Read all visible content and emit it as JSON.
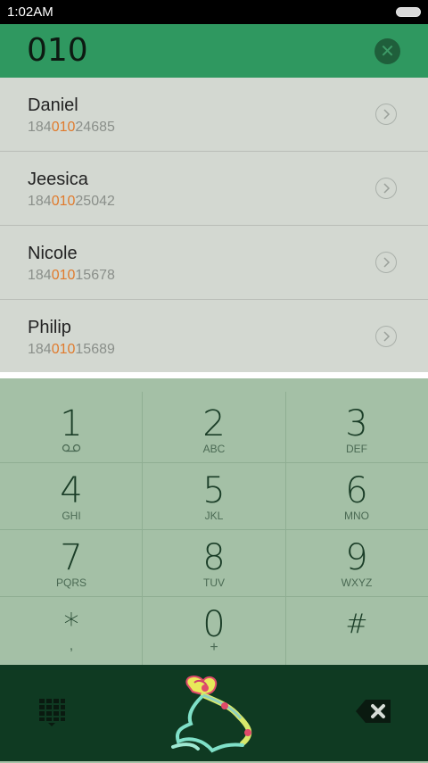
{
  "status_bar": {
    "time": "1:02AM"
  },
  "header": {
    "number": "010"
  },
  "results": [
    {
      "name": "Daniel",
      "prefix": "184",
      "match": "010",
      "suffix": "24685"
    },
    {
      "name": "Jeesica",
      "prefix": "184",
      "match": "010",
      "suffix": "25042"
    },
    {
      "name": "Nicole",
      "prefix": "184",
      "match": "010",
      "suffix": "15678"
    },
    {
      "name": "Philip",
      "prefix": "184",
      "match": "010",
      "suffix": "15689"
    }
  ],
  "keypad": {
    "keys": [
      {
        "digit": "1",
        "letters": ""
      },
      {
        "digit": "2",
        "letters": "ABC"
      },
      {
        "digit": "3",
        "letters": "DEF"
      },
      {
        "digit": "4",
        "letters": "GHI"
      },
      {
        "digit": "5",
        "letters": "JKL"
      },
      {
        "digit": "6",
        "letters": "MNO"
      },
      {
        "digit": "7",
        "letters": "PQRS"
      },
      {
        "digit": "8",
        "letters": "TUV"
      },
      {
        "digit": "9",
        "letters": "WXYZ"
      },
      {
        "digit": "*",
        "letters": ","
      },
      {
        "digit": "0",
        "letters": "+"
      },
      {
        "digit": "#",
        "letters": ""
      }
    ]
  },
  "colors": {
    "header_bg": "#2f9860",
    "results_bg": "#d3d8d1",
    "keypad_bg": "#a4c0a6",
    "bottom_bar_bg": "#0f3a22",
    "match_highlight": "#e07a2c"
  },
  "icons": {
    "clear": "clear-icon",
    "detail": "chevron-right-circle-icon",
    "voicemail": "voicemail-icon",
    "dialpad": "dialpad-icon",
    "call": "call-icon",
    "backspace": "backspace-icon",
    "battery": "battery-icon"
  }
}
